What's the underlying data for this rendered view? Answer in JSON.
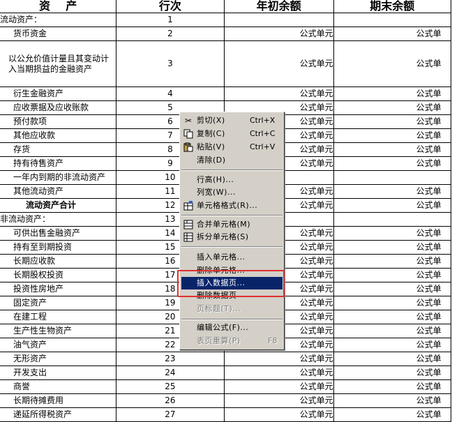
{
  "sheet": {
    "headers": [
      "资    产",
      "行次",
      "年初余额",
      "期末余额"
    ],
    "rows": [
      {
        "name": "流动资产：",
        "line": "1",
        "v1": "",
        "v2": ""
      },
      {
        "name": "货币资金",
        "line": "2",
        "v1": "公式单元",
        "v2": "公式单"
      },
      {
        "name": "以公允价值计量且其变动计入当期损益的金融资产",
        "line": "3",
        "v1": "公式单元",
        "v2": "公式单"
      },
      {
        "name": "衍生金融资产",
        "line": "4",
        "v1": "公式单元",
        "v2": "公式单"
      },
      {
        "name": "应收票据及应收账款",
        "line": "5",
        "v1": "公式单元",
        "v2": "公式单"
      },
      {
        "name": "预付款项",
        "line": "6",
        "v1": "公式单元",
        "v2": "公式单"
      },
      {
        "name": "其他应收款",
        "line": "7",
        "v1": "公式单元",
        "v2": "公式单"
      },
      {
        "name": "存货",
        "line": "8",
        "v1": "公式单元",
        "v2": "公式单"
      },
      {
        "name": "持有待售资产",
        "line": "9",
        "v1": "公式单元",
        "v2": "公式单"
      },
      {
        "name": "一年内到期的非流动资产",
        "line": "10",
        "v1": "",
        "v2": ""
      },
      {
        "name": "其他流动资产",
        "line": "11",
        "v1": "公式单元",
        "v2": "公式单"
      },
      {
        "name": "流动资产合计",
        "line": "12",
        "v1": "公式单元",
        "v2": "公式单"
      },
      {
        "name": "非流动资产：",
        "line": "13",
        "v1": "",
        "v2": ""
      },
      {
        "name": "可供出售金融资产",
        "line": "14",
        "v1": "公式单元",
        "v2": "公式单"
      },
      {
        "name": "持有至到期投资",
        "line": "15",
        "v1": "公式单元",
        "v2": "公式单"
      },
      {
        "name": "长期应收款",
        "line": "16",
        "v1": "公式单元",
        "v2": "公式单"
      },
      {
        "name": "长期股权投资",
        "line": "17",
        "v1": "公式单元",
        "v2": "公式单"
      },
      {
        "name": "投资性房地产",
        "line": "18",
        "v1": "公式单元",
        "v2": "公式单"
      },
      {
        "name": "固定资产",
        "line": "19",
        "v1": "公式单元",
        "v2": "公式单"
      },
      {
        "name": "在建工程",
        "line": "20",
        "v1": "公式单元",
        "v2": "公式单"
      },
      {
        "name": "生产性生物资产",
        "line": "21",
        "v1": "公式单元",
        "v2": "公式单"
      },
      {
        "name": "油气资产",
        "line": "22",
        "v1": "公式单元",
        "v2": "公式单"
      },
      {
        "name": "无形资产",
        "line": "23",
        "v1": "公式单元",
        "v2": "公式单"
      },
      {
        "name": "开发支出",
        "line": "24",
        "v1": "公式单元",
        "v2": "公式单"
      },
      {
        "name": "商誉",
        "line": "25",
        "v1": "公式单元",
        "v2": "公式单"
      },
      {
        "name": "长期待摊费用",
        "line": "26",
        "v1": "公式单元",
        "v2": "公式单"
      },
      {
        "name": "递延所得税资产",
        "line": "27",
        "v1": "公式单元",
        "v2": "公式单"
      }
    ]
  },
  "context_menu": {
    "cut": {
      "label": "剪切(X)",
      "shortcut": "Ctrl+X",
      "icon": "scissors-icon"
    },
    "copy": {
      "label": "复制(C)",
      "shortcut": "Ctrl+C",
      "icon": "copy-icon"
    },
    "paste": {
      "label": "粘贴(V)",
      "shortcut": "Ctrl+V",
      "icon": "paste-icon"
    },
    "clear": {
      "label": "清除(D)"
    },
    "row_height": {
      "label": "行高(H)..."
    },
    "col_width": {
      "label": "列宽(W)..."
    },
    "cell_format": {
      "label": "单元格格式(R)...",
      "icon": "cell-format-icon"
    },
    "merge_cells": {
      "label": "合并单元格(M)",
      "icon": "merge-cells-icon"
    },
    "split_cells": {
      "label": "拆分单元格(S)",
      "icon": "split-cells-icon"
    },
    "insert_cell": {
      "label": "插入单元格..."
    },
    "delete_cell": {
      "label": "删除单元格..."
    },
    "insert_page": {
      "label": "插入数据页..."
    },
    "delete_page": {
      "label": "删除数据页"
    },
    "page_title": {
      "label": "页标题(T)..."
    },
    "edit_formula": {
      "label": "编辑公式(F)..."
    },
    "recalc_page": {
      "label": "表页重算(P)",
      "shortcut": "F8"
    }
  },
  "colors": {
    "highlight_box": "#e03030",
    "menu_selection": "#0a246a",
    "menu_bg": "#d4d0c8"
  }
}
